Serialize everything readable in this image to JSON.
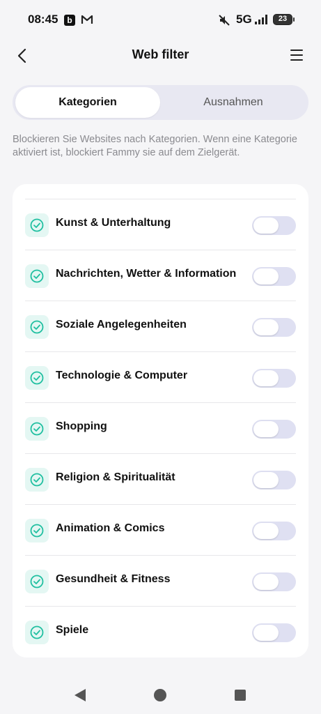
{
  "status_bar": {
    "time": "08:45",
    "b_badge": "b",
    "network": "5G",
    "battery": "23"
  },
  "header": {
    "title": "Web filter"
  },
  "tabs": [
    {
      "label": "Kategorien",
      "active": true
    },
    {
      "label": "Ausnahmen",
      "active": false
    }
  ],
  "description": "Blockieren Sie Websites nach Kategorien. Wenn eine Kategorie aktiviert ist, blockiert Fammy sie auf dem Zielgerät.",
  "categories": [
    {
      "label": "Kunst & Unterhaltung",
      "enabled": false
    },
    {
      "label": "Nachrichten, Wetter & Information",
      "enabled": false
    },
    {
      "label": "Soziale Angelegenheiten",
      "enabled": false
    },
    {
      "label": "Technologie & Computer",
      "enabled": false
    },
    {
      "label": "Shopping",
      "enabled": false
    },
    {
      "label": "Religion & Spiritualität",
      "enabled": false
    },
    {
      "label": "Animation & Comics",
      "enabled": false
    },
    {
      "label": "Gesundheit & Fitness",
      "enabled": false
    },
    {
      "label": "Spiele",
      "enabled": false
    }
  ],
  "colors": {
    "accent": "#1fbfa0",
    "check_bg": "#e4f7f3",
    "toggle_off": "#dfe0f2",
    "tab_track": "#e8e8f2"
  }
}
